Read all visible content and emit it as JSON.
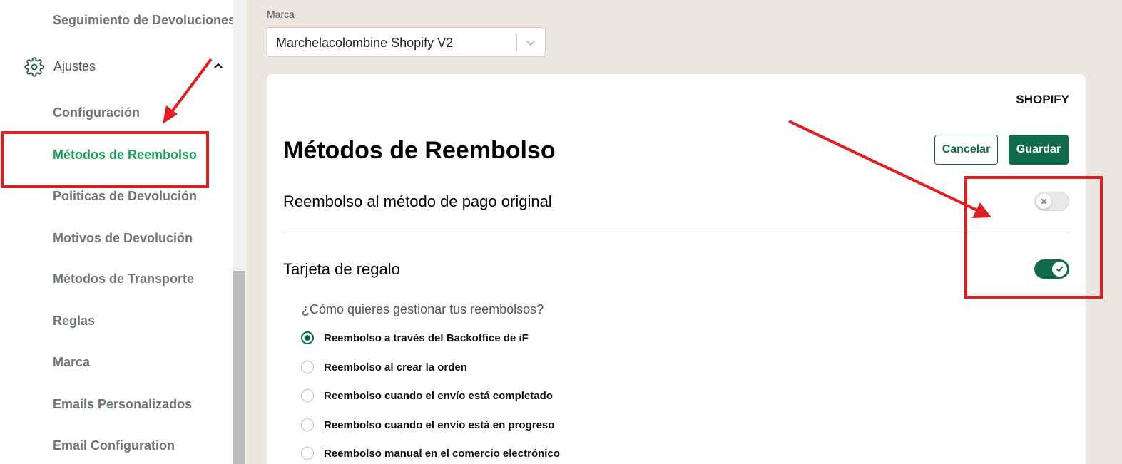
{
  "sidebar": {
    "items_top": {
      "label": "Seguimiento de Devoluciones"
    },
    "settings": {
      "label": "Ajustes",
      "icon": "gear-icon",
      "expand_icon": "chevron-up-icon"
    },
    "items": [
      {
        "label": "Configuración",
        "active": false
      },
      {
        "label": "Métodos de Reembolso",
        "active": true
      },
      {
        "label": "Politicas de Devolución",
        "active": false
      },
      {
        "label": "Motivos de Devolución",
        "active": false
      },
      {
        "label": "Métodos de Transporte",
        "active": false
      },
      {
        "label": "Reglas",
        "active": false
      },
      {
        "label": "Marca",
        "active": false
      },
      {
        "label": "Emails Personalizados",
        "active": false
      },
      {
        "label": "Email Configuration",
        "active": false
      }
    ],
    "active_color": "#1e9e57"
  },
  "brand": {
    "label": "Marca",
    "selected": "Marchelacolombine Shopify V2",
    "caret_icon": "chevron-down-icon"
  },
  "card": {
    "platform": "SHOPIFY",
    "title": "Métodos de Reembolso",
    "cancel_label": "Cancelar",
    "save_label": "Guardar",
    "original_payment": {
      "label": "Reembolso al método de pago original",
      "enabled": false
    },
    "gift_card": {
      "label": "Tarjeta de regalo",
      "enabled": true
    },
    "question": "¿Cómo quieres gestionar tus reembolsos?",
    "options": [
      {
        "label": "Reembolso a través del Backoffice de iF",
        "selected": true
      },
      {
        "label": "Reembolso al crear la orden",
        "selected": false
      },
      {
        "label": "Reembolso cuando el envío está completado",
        "selected": false
      },
      {
        "label": "Reembolso cuando el envío está en progreso",
        "selected": false
      },
      {
        "label": "Reembolso manual en el comercio electrónico",
        "selected": false
      }
    ]
  },
  "colors": {
    "primary": "#0f6b4b",
    "background": "#ebe7e0",
    "annotation": "#e02020"
  }
}
